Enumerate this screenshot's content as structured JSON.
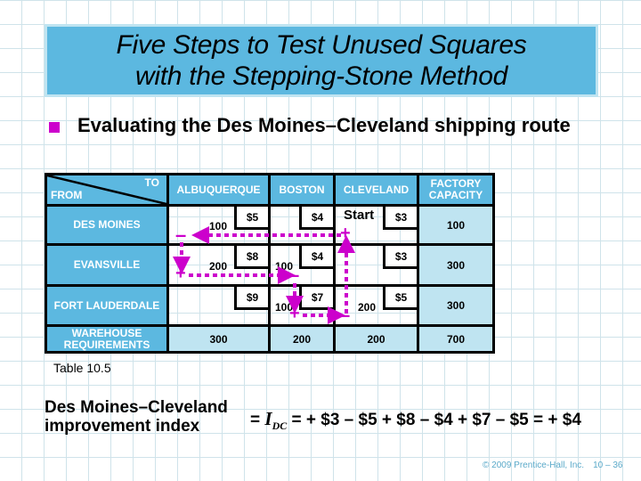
{
  "slide": {
    "title_lines": [
      "Five Steps to Test Unused Squares",
      "with the Stepping-Stone Method"
    ],
    "bullet": "Evaluating the Des Moines–Cleveland shipping route",
    "colors": {
      "title_fill": "#5cb8e0",
      "bullet": "#cc00cc",
      "route": "#cc00cc",
      "header_fill": "#5cb8e0",
      "totals_fill": "#bfe4f1"
    }
  },
  "table": {
    "corner_to": "TO",
    "corner_from": "FROM",
    "columns": [
      "ALBUQUERQUE",
      "BOSTON",
      "CLEVELAND"
    ],
    "capacity_header": "FACTORY CAPACITY",
    "rows": [
      {
        "name": "DES MOINES",
        "costs": [
          "$5",
          "$4",
          "$3"
        ],
        "quantities": [
          "100",
          "",
          ""
        ],
        "capacity": "100"
      },
      {
        "name": "EVANSVILLE",
        "costs": [
          "$8",
          "$4",
          "$3"
        ],
        "quantities": [
          "200",
          "100",
          ""
        ],
        "capacity": "300"
      },
      {
        "name": "FORT LAUDERDALE",
        "costs": [
          "$9",
          "$7",
          "$5"
        ],
        "quantities": [
          "",
          "100",
          "200"
        ],
        "capacity": "300"
      }
    ],
    "requirements_label": "WAREHOUSE REQUIREMENTS",
    "requirements": [
      "300",
      "200",
      "200"
    ],
    "total": "700",
    "start_label": "Start",
    "route_signs": {
      "des_moines_albuquerque": "–",
      "des_moines_cleveland": "+",
      "evansville_albuquerque": "+",
      "evansville_boston": "–",
      "fort_lauderdale_boston": "+",
      "fort_lauderdale_cleveland": "–"
    }
  },
  "caption": "Table 10.5",
  "formula": {
    "label_line1": "Des Moines–Cleveland",
    "label_line2": "improvement index",
    "eq1": "= ",
    "index_symbol": "I",
    "index_sub": "DC",
    "rhs": " = + $3 – $5 + $8 – $4 + $7 – $5 = + $4"
  },
  "footer": {
    "copyright": "© 2009 Prentice-Hall, Inc.",
    "page": "10 – 36"
  }
}
